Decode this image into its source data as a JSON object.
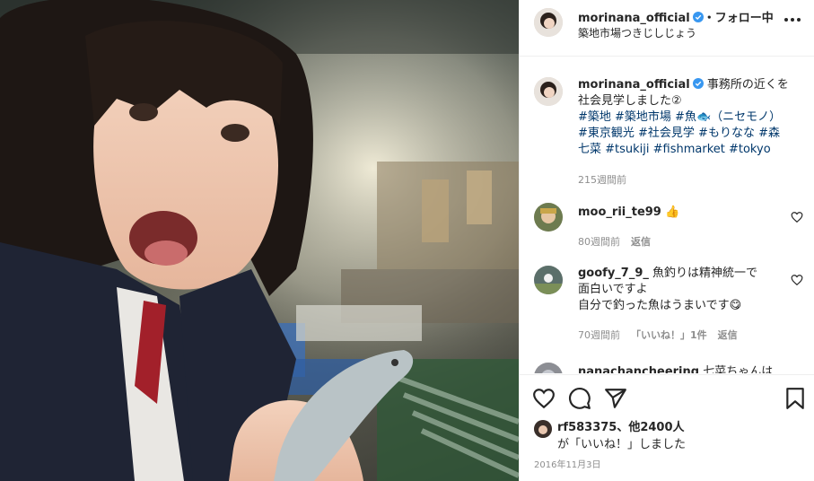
{
  "header": {
    "username": "morinana_official",
    "separator": "・",
    "follow_status": "フォロー中",
    "location": "築地市場つきじしじょう"
  },
  "caption": {
    "username": "morinana_official",
    "text_line1": "事務所の近くを",
    "text_line2": "社会見学しました②",
    "tags_line1": "#築地 #築地市場 #魚🐟（ニセモノ）",
    "tags_line2": "#東京観光 #社会見学 #もりなな #森",
    "tags_line3": "七菜 #tsukiji #fishmarket #tokyo",
    "time": "215週間前"
  },
  "comments": [
    {
      "username": "moo_rii_te99",
      "text": "👍",
      "time": "80週間前",
      "reply": "返信"
    },
    {
      "username": "goofy_7_9_",
      "line1": "魚釣りは精神統一で",
      "line2": "面白いですよ",
      "line3": "自分で釣った魚はうまいです😋",
      "time": "70週間前",
      "likes": "「いいね！」1件",
      "reply": "返信"
    },
    {
      "username": "nanachancheering",
      "text": "七菜ちゃんは"
    }
  ],
  "likes": {
    "line1": "rf583375、他2400人",
    "line2": "が「いいね！」しました"
  },
  "date": "2016年11月3日",
  "colors": {
    "link": "#00376b",
    "verified": "#3897f0",
    "muted": "#8e8e8e"
  }
}
